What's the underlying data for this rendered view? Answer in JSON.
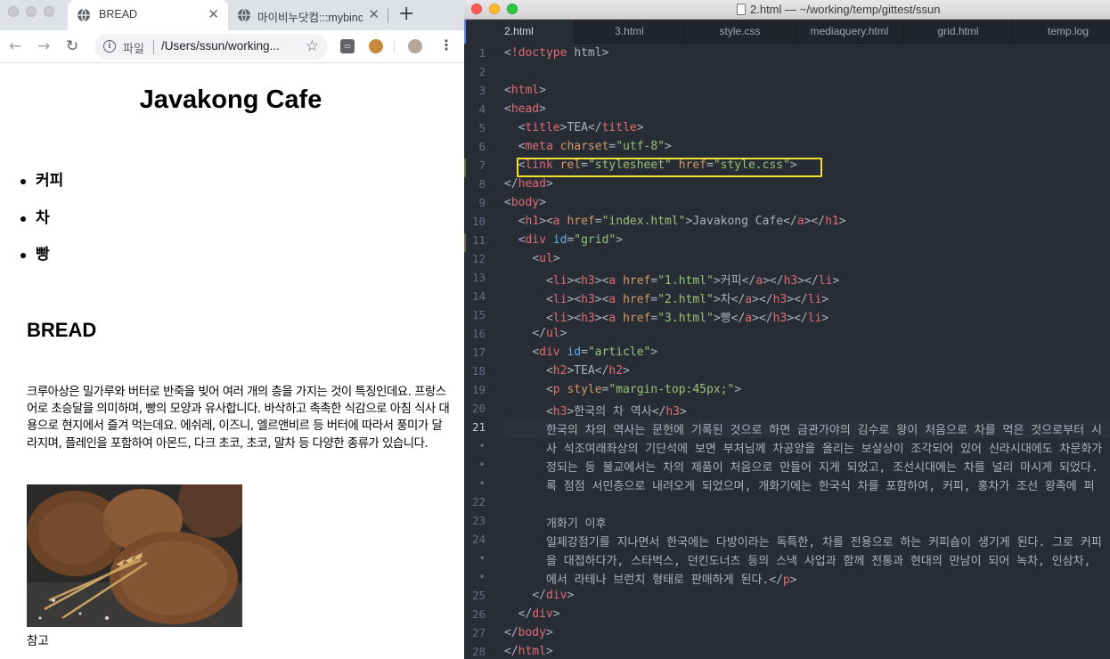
{
  "browser": {
    "tabs": [
      {
        "title": "BREAD",
        "active": true
      },
      {
        "title": "마이비누닷컴:::mybinc",
        "active": false
      }
    ],
    "scheme_label": "파일",
    "url": "/Users/ssun/working...",
    "page": {
      "heading": "Javakong Cafe",
      "menu": [
        "커피",
        "차",
        "빵"
      ],
      "article_title": "BREAD",
      "article_text": "크루아상은 밀가루와 버터로 반죽을 빚어 여러 개의 층을 가지는 것이 특징인데요. 프랑스어로 초승달을 의미하며, 빵의 모양과 유사합니다. 바삭하고 촉촉한 식감으로 아침 식사 대용으로 현지에서 즐겨 먹는데요. 에쉬레, 이즈니, 엘르앤비르 등 버터에 따라서 풍미가 달라지며, 플레인을 포함하여 아몬드, 다크 초코, 초코, 말차 등 다양한 종류가 있습니다.",
      "caption": "참고"
    }
  },
  "editor": {
    "window_title": "2.html — ~/working/temp/gittest/ssun",
    "tabs": [
      "2.html",
      "3.html",
      "style.css",
      "mediaquery.html",
      "grid.html",
      "temp.log"
    ],
    "active_tab": "2.html",
    "line_numbers": [
      "1",
      "2",
      "3",
      "4",
      "5",
      "6",
      "7",
      "8",
      "9",
      "10",
      "11",
      "12",
      "13",
      "14",
      "15",
      "16",
      "17",
      "18",
      "19",
      "20",
      "21",
      "•",
      "•",
      "•",
      "22",
      "23",
      "24",
      "•",
      "•",
      "25",
      "26",
      "27",
      "28"
    ],
    "current_line": "21"
  },
  "colors": {
    "editor_bg": "#282c34",
    "tag": "#e06c75",
    "attr": "#d19a66",
    "string": "#98c379",
    "highlight_box": "#f2e22e"
  }
}
